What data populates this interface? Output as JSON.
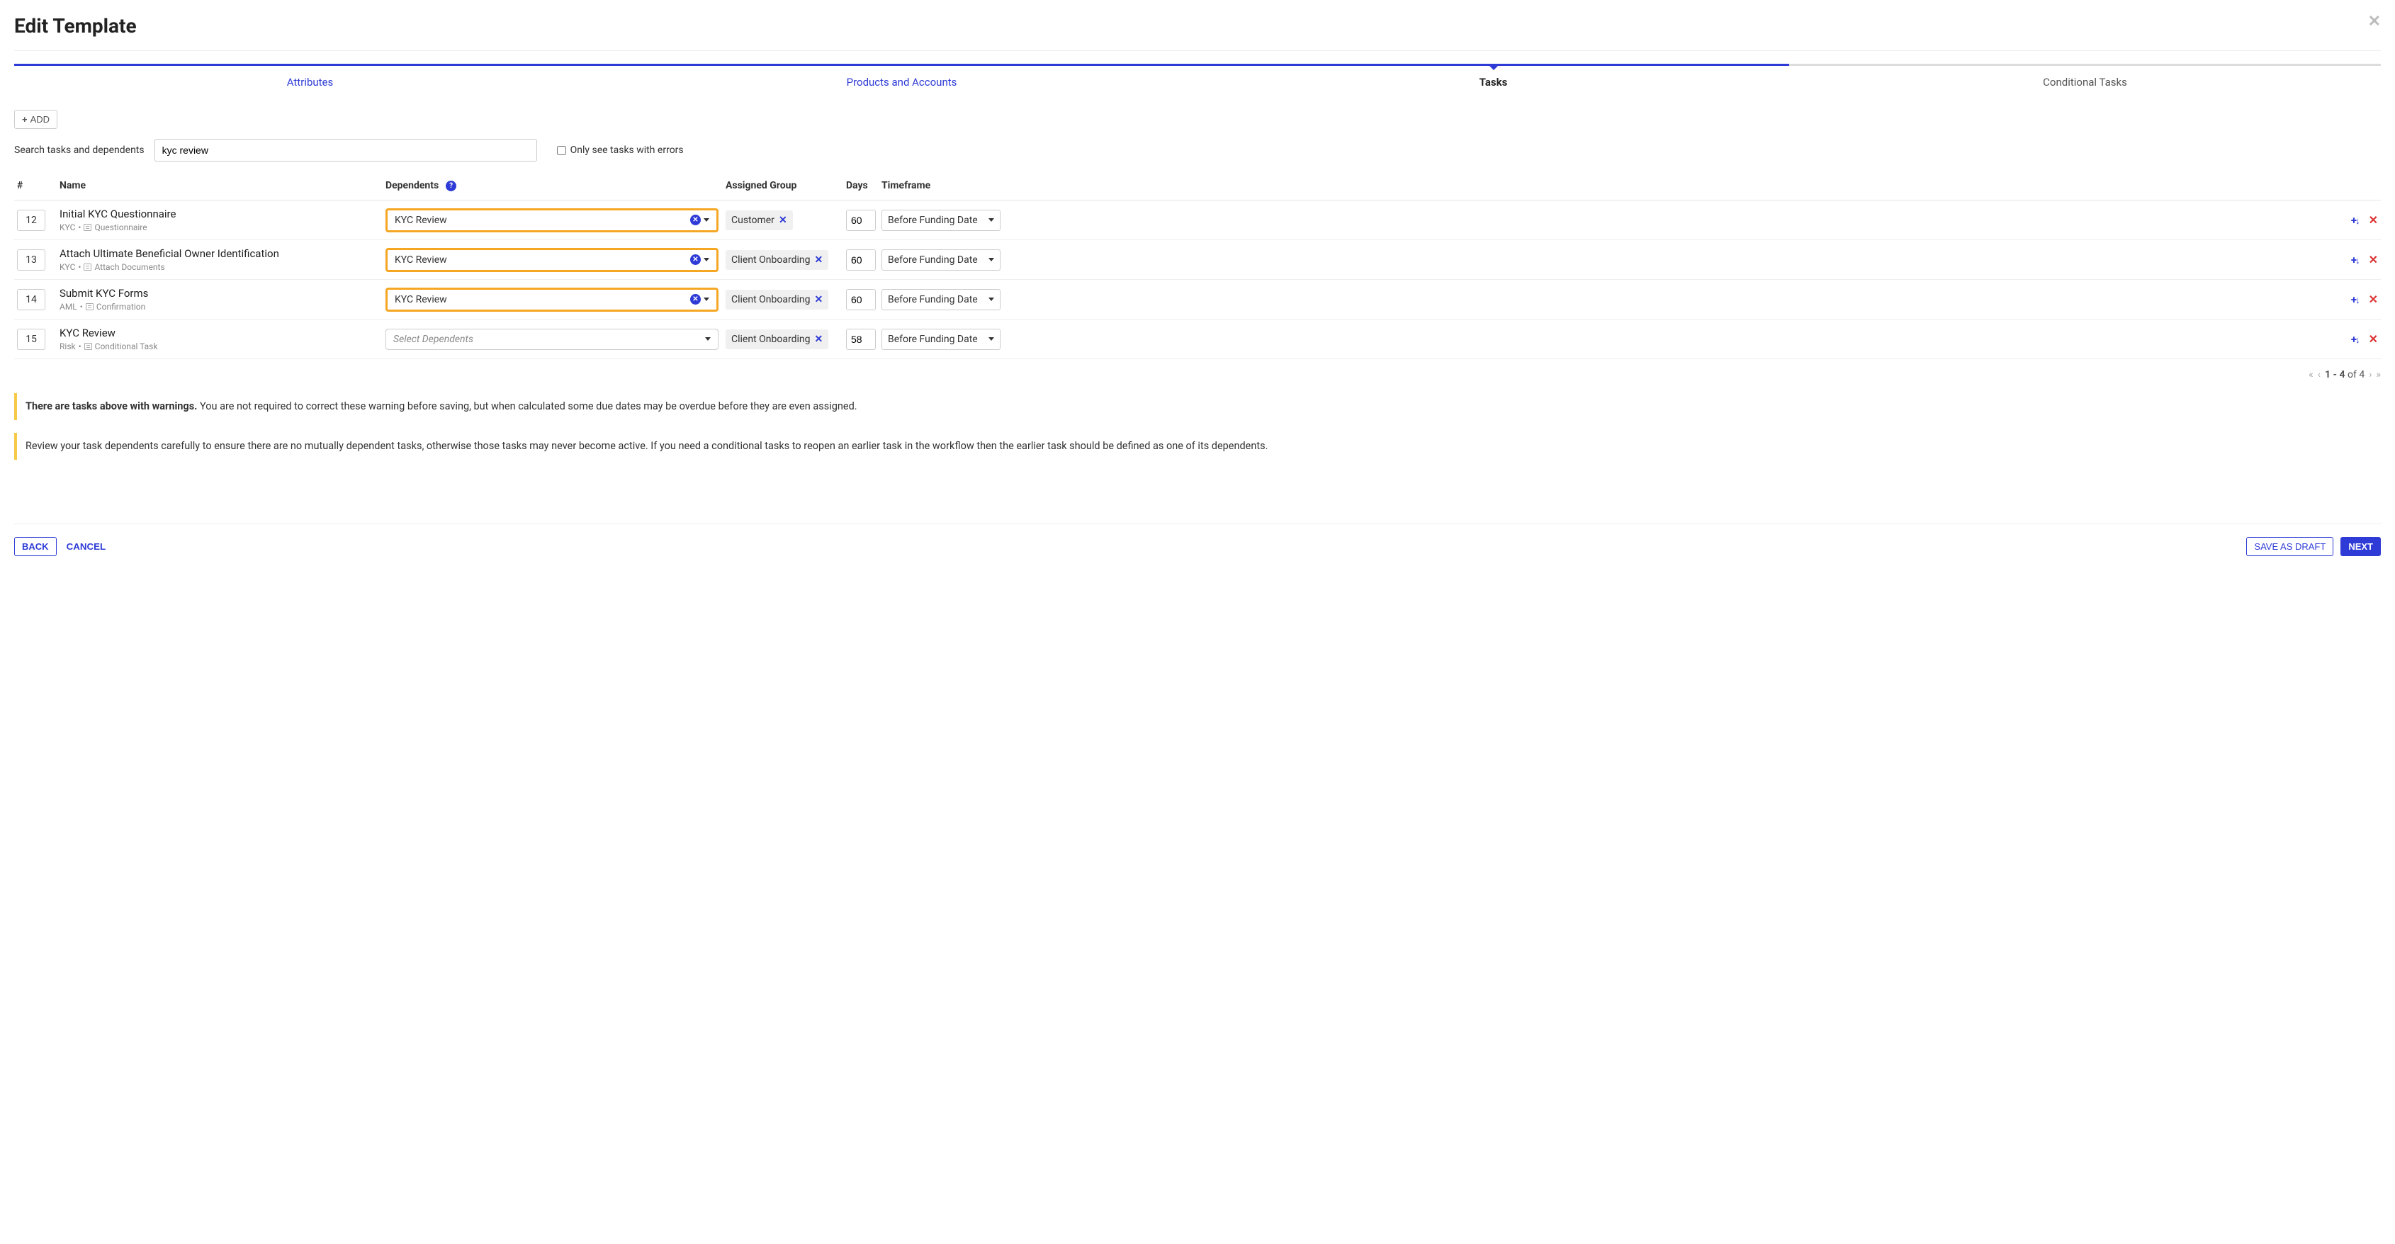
{
  "header": {
    "title": "Edit Template"
  },
  "tabs": [
    {
      "label": "Attributes",
      "state": "done"
    },
    {
      "label": "Products and Accounts",
      "state": "done"
    },
    {
      "label": "Tasks",
      "state": "active"
    },
    {
      "label": "Conditional Tasks",
      "state": "pending"
    }
  ],
  "toolbar": {
    "add_label": "ADD"
  },
  "search": {
    "label": "Search tasks and dependents",
    "value": "kyc review"
  },
  "errors_checkbox": {
    "label": "Only see tasks with errors",
    "checked": false
  },
  "columns": {
    "num": "#",
    "name": "Name",
    "dependents": "Dependents",
    "group": "Assigned Group",
    "days": "Days",
    "timeframe": "Timeframe"
  },
  "dependents_placeholder": "Select Dependents",
  "rows": [
    {
      "num": "12",
      "name": "Initial KYC Questionnaire",
      "cat": "KYC",
      "type": "Questionnaire",
      "dep": "KYC Review",
      "highlight": true,
      "group": "Customer",
      "days": "60",
      "tf": "Before Funding Date"
    },
    {
      "num": "13",
      "name": "Attach Ultimate Beneficial Owner Identification",
      "cat": "KYC",
      "type": "Attach Documents",
      "dep": "KYC Review",
      "highlight": true,
      "group": "Client Onboarding",
      "days": "60",
      "tf": "Before Funding Date"
    },
    {
      "num": "14",
      "name": "Submit KYC Forms",
      "cat": "AML",
      "type": "Confirmation",
      "dep": "KYC Review",
      "highlight": true,
      "group": "Client Onboarding",
      "days": "60",
      "tf": "Before Funding Date"
    },
    {
      "num": "15",
      "name": "KYC Review",
      "cat": "Risk",
      "type": "Conditional Task",
      "dep": "",
      "highlight": false,
      "group": "Client Onboarding",
      "days": "58",
      "tf": "Before Funding Date"
    }
  ],
  "pager": {
    "range": "1 - 4",
    "of_word": "of",
    "total": "4"
  },
  "warnings": [
    {
      "bold": "There are tasks above with warnings.",
      "text": " You are not required to correct these warning before saving, but when calculated some due dates may be overdue before they are even assigned."
    },
    {
      "bold": "",
      "text": "Review your task dependents carefully to ensure there are no mutually dependent tasks, otherwise those tasks may never become active. If you need a conditional tasks to reopen an earlier task in the workflow then the earlier task should be defined as one of its dependents."
    }
  ],
  "footer": {
    "back": "BACK",
    "cancel": "CANCEL",
    "save_draft": "SAVE AS DRAFT",
    "next": "NEXT"
  }
}
